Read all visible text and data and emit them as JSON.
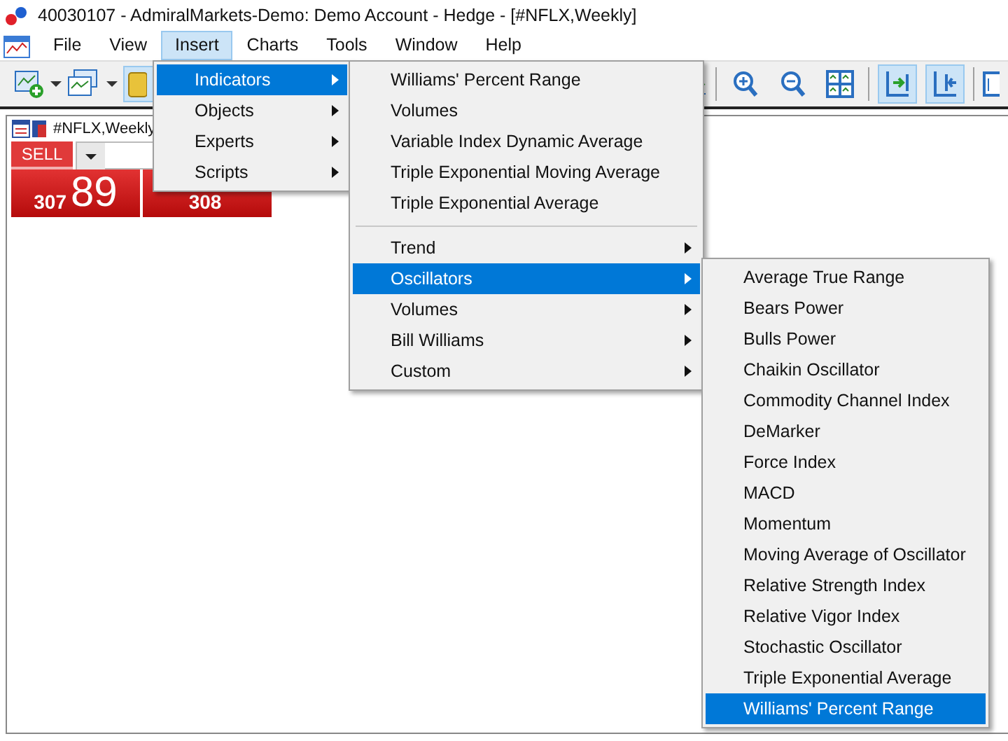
{
  "window": {
    "title": "40030107 - AdmiralMarkets-Demo: Demo Account - Hedge - [#NFLX,Weekly]"
  },
  "menubar": [
    {
      "label": "File",
      "selected": false
    },
    {
      "label": "View",
      "selected": false
    },
    {
      "label": "Insert",
      "selected": true
    },
    {
      "label": "Charts",
      "selected": false
    },
    {
      "label": "Tools",
      "selected": false
    },
    {
      "label": "Window",
      "selected": false
    },
    {
      "label": "Help",
      "selected": false
    }
  ],
  "toolbar": [
    {
      "kind": "zoom-in",
      "pressed": false
    },
    {
      "kind": "zoom-out",
      "pressed": false
    },
    {
      "kind": "tile",
      "pressed": false
    },
    {
      "kind": "shift",
      "pressed": true
    },
    {
      "kind": "autoscroll",
      "pressed": true
    }
  ],
  "chart_window": {
    "symbol": "#NFLX,Weekly",
    "sell_label": "SELL",
    "bid_big": "307",
    "bid_small": "89",
    "ask_big": "308"
  },
  "insert_menu": [
    {
      "label": "Indicators",
      "submenu": true,
      "selected": true
    },
    {
      "label": "Objects",
      "submenu": true,
      "selected": false
    },
    {
      "label": "Experts",
      "submenu": true,
      "selected": false
    },
    {
      "label": "Scripts",
      "submenu": true,
      "selected": false
    }
  ],
  "indicators_menu": [
    {
      "kind": "item",
      "label": "Williams' Percent Range",
      "submenu": false,
      "selected": false
    },
    {
      "kind": "item",
      "label": "Volumes",
      "submenu": false,
      "selected": false
    },
    {
      "kind": "item",
      "label": "Variable Index Dynamic Average",
      "submenu": false,
      "selected": false
    },
    {
      "kind": "item",
      "label": "Triple Exponential Moving Average",
      "submenu": false,
      "selected": false
    },
    {
      "kind": "item",
      "label": "Triple Exponential Average",
      "submenu": false,
      "selected": false
    },
    {
      "kind": "separator"
    },
    {
      "kind": "item",
      "label": "Trend",
      "submenu": true,
      "selected": false
    },
    {
      "kind": "item",
      "label": "Oscillators",
      "submenu": true,
      "selected": true
    },
    {
      "kind": "item",
      "label": "Volumes",
      "submenu": true,
      "selected": false
    },
    {
      "kind": "item",
      "label": "Bill Williams",
      "submenu": true,
      "selected": false
    },
    {
      "kind": "item",
      "label": "Custom",
      "submenu": true,
      "selected": false
    }
  ],
  "oscillators_menu": [
    {
      "label": "Average True Range",
      "selected": false
    },
    {
      "label": "Bears Power",
      "selected": false
    },
    {
      "label": "Bulls Power",
      "selected": false
    },
    {
      "label": "Chaikin Oscillator",
      "selected": false
    },
    {
      "label": "Commodity Channel Index",
      "selected": false
    },
    {
      "label": "DeMarker",
      "selected": false
    },
    {
      "label": "Force Index",
      "selected": false
    },
    {
      "label": "MACD",
      "selected": false
    },
    {
      "label": "Momentum",
      "selected": false
    },
    {
      "label": "Moving Average of Oscillator",
      "selected": false
    },
    {
      "label": "Relative Strength Index",
      "selected": false
    },
    {
      "label": "Relative Vigor Index",
      "selected": false
    },
    {
      "label": "Stochastic Oscillator",
      "selected": false
    },
    {
      "label": "Triple Exponential Average",
      "selected": false
    },
    {
      "label": "Williams' Percent Range",
      "selected": true
    }
  ]
}
